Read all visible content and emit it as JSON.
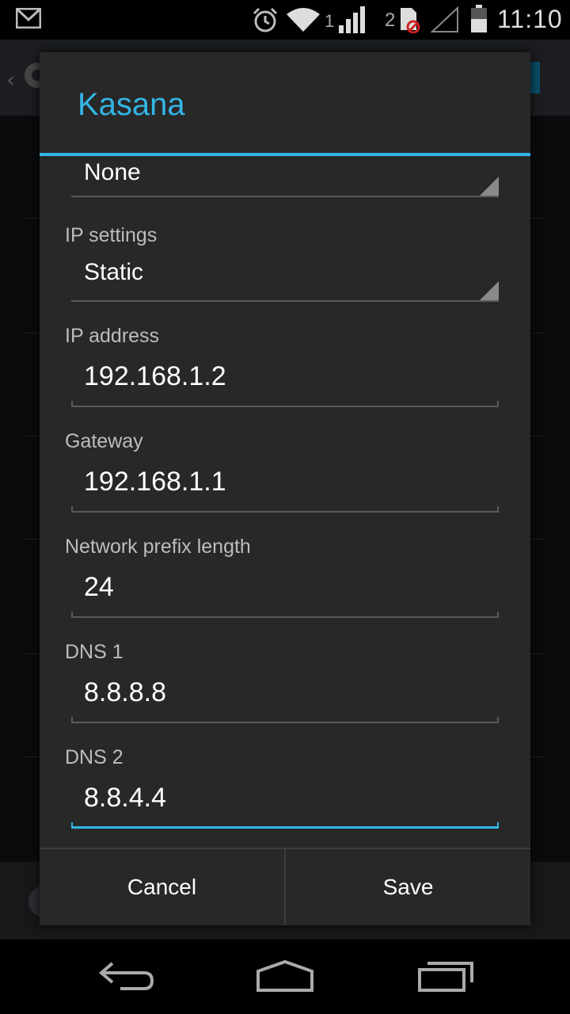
{
  "status_bar": {
    "time": "11:10",
    "sim1_number": "1",
    "sim2_number": "2",
    "icons": [
      "gmail-icon",
      "alarm-icon",
      "wifi-icon",
      "signal-icon",
      "sim-blocked-icon",
      "signal-empty-icon",
      "battery-icon"
    ]
  },
  "dialog": {
    "title": "Kasana",
    "proxy_value": "None",
    "ip_settings_label": "IP settings",
    "ip_settings_value": "Static",
    "ip_address_label": "IP address",
    "ip_address_value": "192.168.1.2",
    "gateway_label": "Gateway",
    "gateway_value": "192.168.1.1",
    "prefix_label": "Network prefix length",
    "prefix_value": "24",
    "dns1_label": "DNS 1",
    "dns1_value": "8.8.8.8",
    "dns2_label": "DNS 2",
    "dns2_value": "8.8.4.4",
    "cancel_label": "Cancel",
    "save_label": "Save"
  },
  "nav_bar": {
    "icons": [
      "back-icon",
      "home-icon",
      "recents-icon"
    ]
  },
  "colors": {
    "accent": "#33b5e5",
    "dialog_bg": "#282828",
    "label": "#bdbdbd"
  }
}
